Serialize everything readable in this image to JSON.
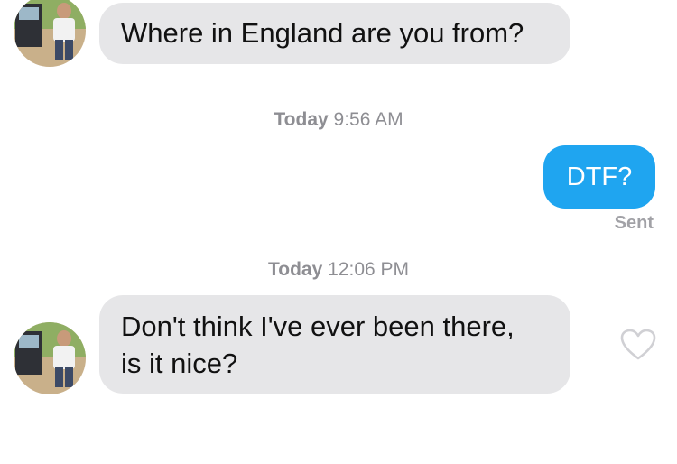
{
  "messages": [
    {
      "text": "Where in England are you from?",
      "direction": "incoming"
    },
    {
      "text": "DTF?",
      "direction": "outgoing",
      "status": "Sent"
    },
    {
      "text_line1": "Don't think I've ever been there,",
      "text_line2": "is it nice?",
      "direction": "incoming"
    }
  ],
  "timestamps": [
    {
      "day": "Today",
      "time": "9:56 AM"
    },
    {
      "day": "Today",
      "time": "12:06 PM"
    }
  ],
  "icons": {
    "avatar": "avatar-photo",
    "like": "heart-outline-icon"
  },
  "colors": {
    "outgoing_bubble": "#1fa5f0",
    "incoming_bubble": "#e6e6e8",
    "meta_text": "#8e8e93"
  }
}
